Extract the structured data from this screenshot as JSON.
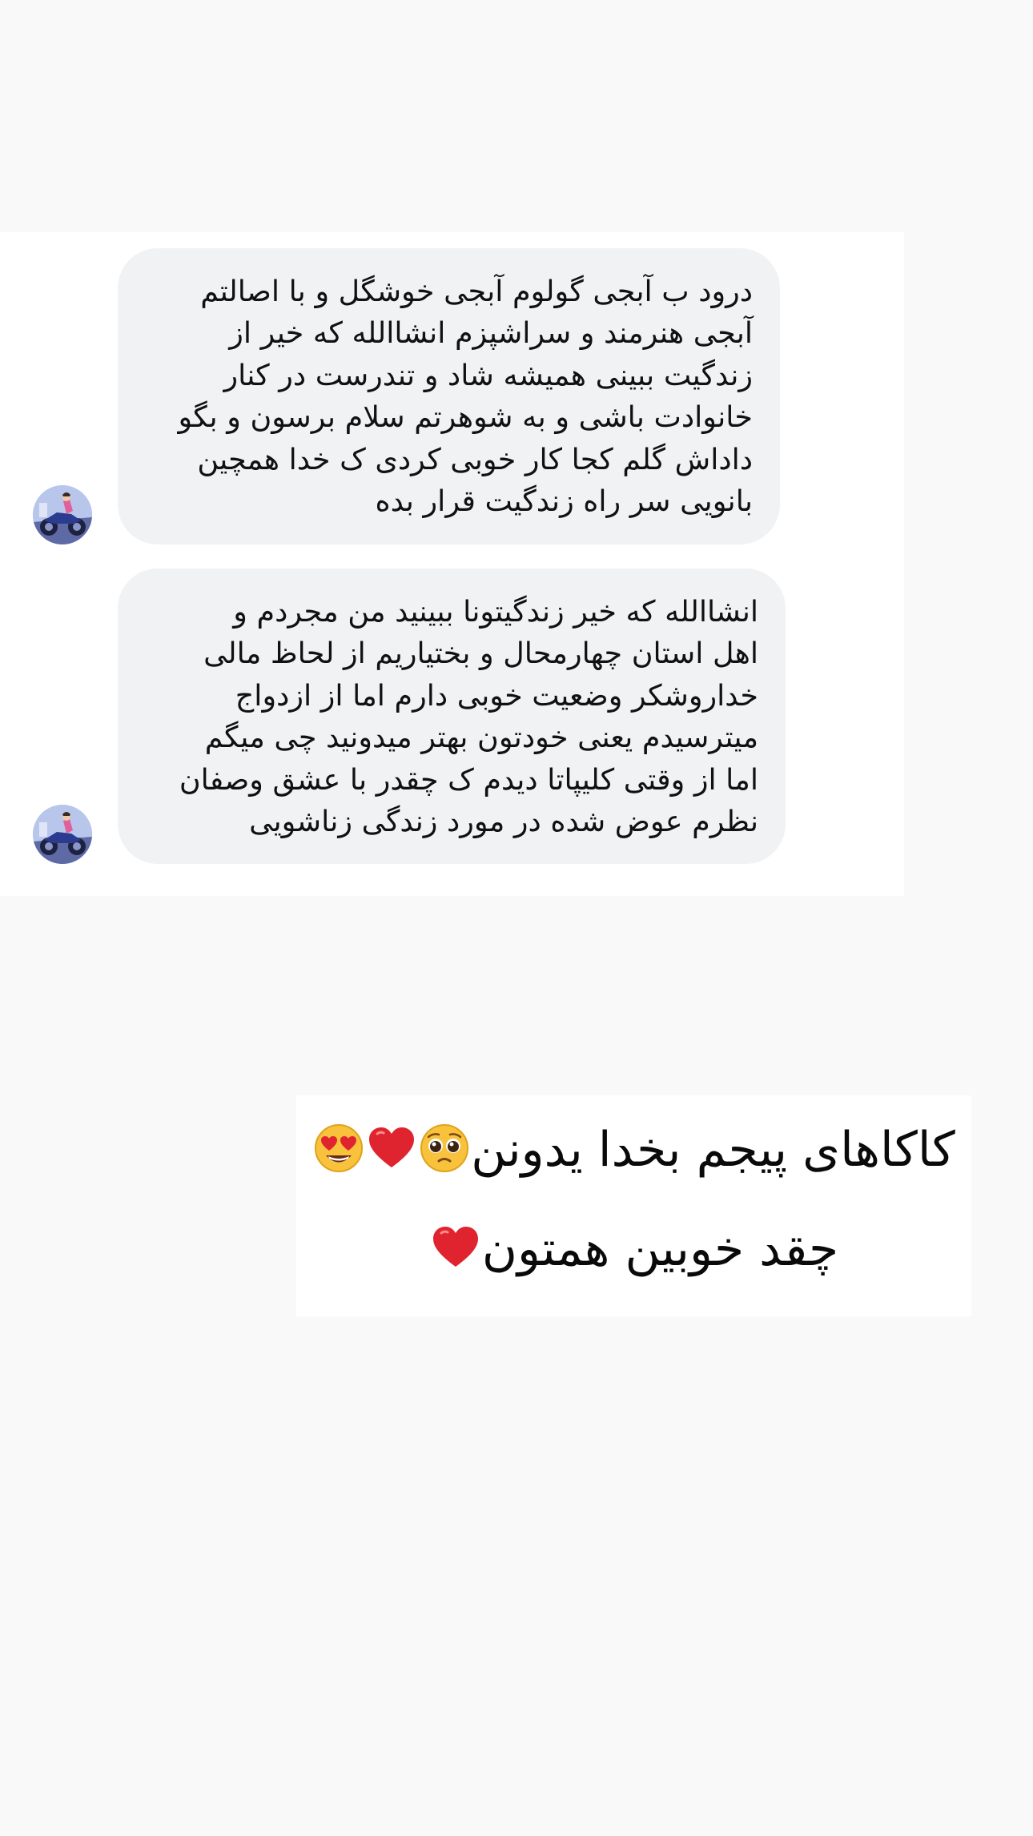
{
  "conversation": {
    "messages": [
      {
        "lines": [
          "درود ب آبجی گولوم آبجی خوشگل و با اصالتم",
          "آبجی هنرمند و سراشپزم انشاالله که خیر از",
          "زندگیت ببینی همیشه شاد و تندرست در کنار",
          "خانوادت باشی و به شوهرتم سلام برسون و بگو",
          "داداش گلم کجا کار خوبی کردی ک خدا همچین",
          "بانویی سر راه زندگیت قرار بده"
        ]
      },
      {
        "lines": [
          "انشاالله که خیر زندگیتونا ببینید من مجردم و",
          "اهل استان چهارمحال و بختیاریم از لحاظ مالی",
          "خداروشکر وضعیت خوبی دارم اما از ازدواج",
          "میترسیدم یعنی خودتون بهتر میدونید چی میگم",
          "اما از وقتی کلیپاتا دیدم ک چقدر با عشق وصفان",
          "نظرم عوض شده در مورد زندگی زناشویی"
        ]
      }
    ]
  },
  "caption": {
    "line1": "کاکاهای پیجم بخدا یدونن",
    "line2": "چقد خوبین همتون",
    "line1_emojis": [
      "pleading-face-emoji",
      "red-heart-emoji",
      "heart-eyes-emoji"
    ],
    "line2_emojis": [
      "red-heart-emoji"
    ]
  },
  "colors": {
    "page_background": "#f9f9f9",
    "panel_background": "#ffffff",
    "bubble_background": "#f1f2f4",
    "text": "#111111",
    "heart": "#e0242f"
  }
}
